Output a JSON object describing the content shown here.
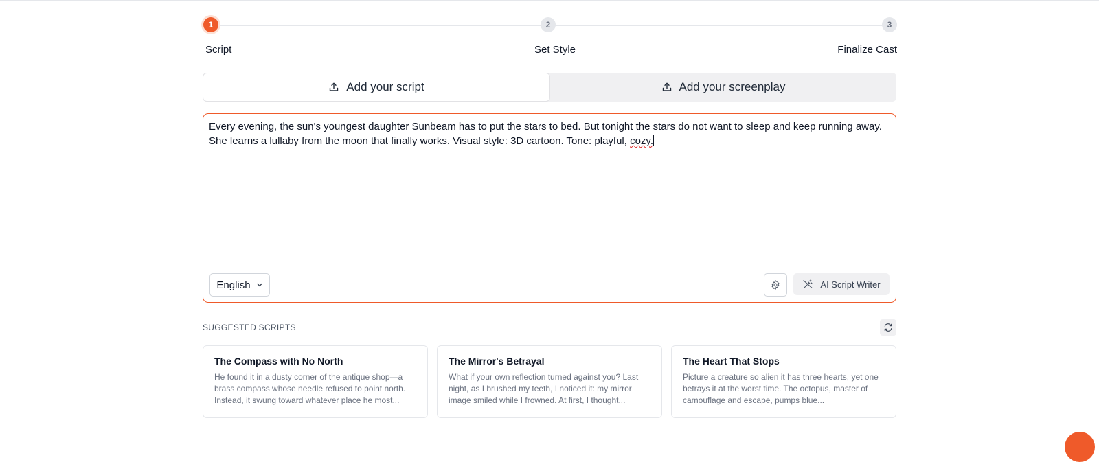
{
  "stepper": {
    "steps": [
      {
        "number": "1",
        "label": "Script"
      },
      {
        "number": "2",
        "label": "Set Style"
      },
      {
        "number": "3",
        "label": "Finalize Cast"
      }
    ],
    "active_step": 1
  },
  "tabs": {
    "script_label": "Add your script",
    "screenplay_label": "Add your screenplay",
    "active": "script"
  },
  "editor": {
    "text_main": "Every evening, the sun's youngest daughter Sunbeam has to put the stars to bed. But tonight the stars do not want to sleep and keep running away. She learns a lullaby from the moon that finally works. Visual style: 3D cartoon. Tone: playful, ",
    "text_flagged": "cozy.",
    "language": "English",
    "ai_button_label": "AI Script Writer"
  },
  "suggested": {
    "heading": "SUGGESTED SCRIPTS",
    "cards": [
      {
        "title": "The Compass with No North",
        "text": "He found it in a dusty corner of the antique shop—a brass compass whose needle refused to point north. Instead, it swung toward whatever place he most..."
      },
      {
        "title": "The Mirror's Betrayal",
        "text": "What if your own reflection turned against you? Last night, as I brushed my teeth, I noticed it: my mirror image smiled while I frowned. At first, I thought..."
      },
      {
        "title": "The Heart That Stops",
        "text": "Picture a creature so alien it has three hearts, yet one betrays it at the worst time. The octopus, master of camouflage and escape, pumps blue..."
      }
    ]
  },
  "colors": {
    "accent": "#ef5a2a",
    "inactive_step": "#e5e7eb",
    "tab_bg": "#f0f0f2"
  }
}
